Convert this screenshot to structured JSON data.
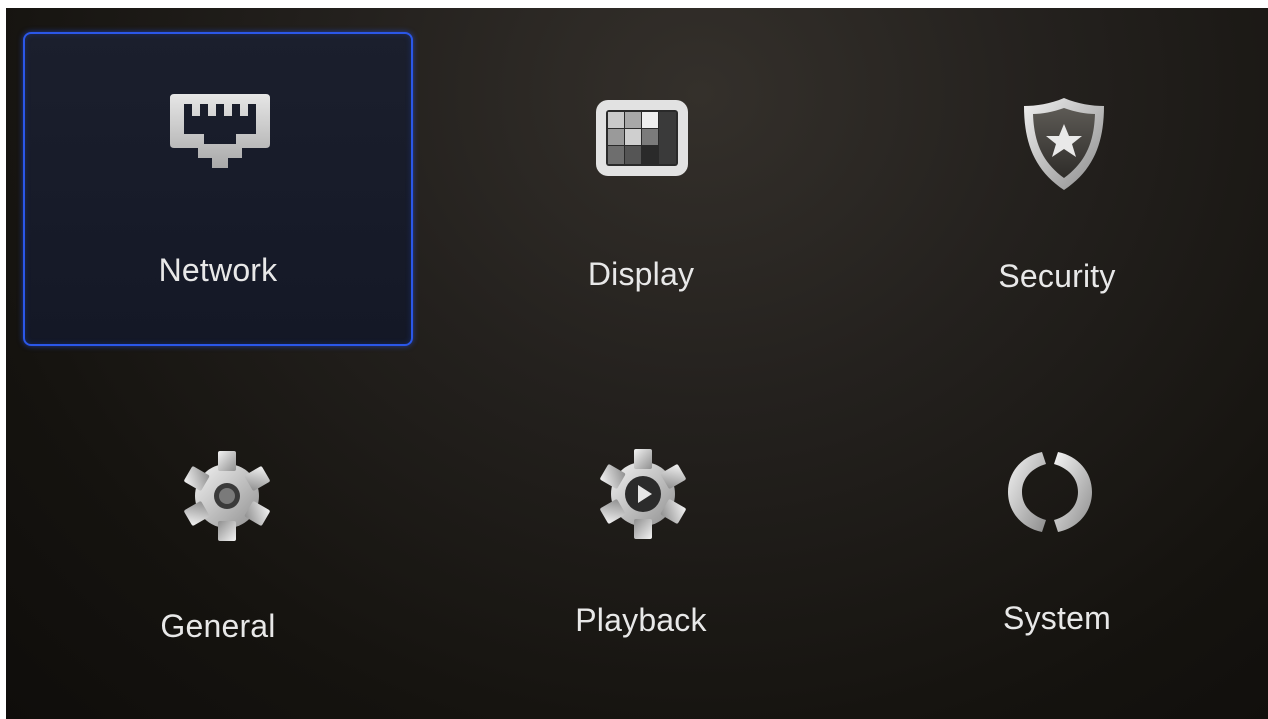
{
  "menu": {
    "items": [
      {
        "label": "Network",
        "icon": "network-port-icon",
        "selected": true
      },
      {
        "label": "Display",
        "icon": "display-layout-icon",
        "selected": false
      },
      {
        "label": "Security",
        "icon": "shield-star-icon",
        "selected": false
      },
      {
        "label": "General",
        "icon": "gear-icon",
        "selected": false
      },
      {
        "label": "Playback",
        "icon": "gear-play-icon",
        "selected": false
      },
      {
        "label": "System",
        "icon": "system-refresh-icon",
        "selected": false
      }
    ]
  },
  "colors": {
    "selection_border": "#2b57e8",
    "label_text": "#e8e8e8",
    "background": "#1c1916"
  }
}
